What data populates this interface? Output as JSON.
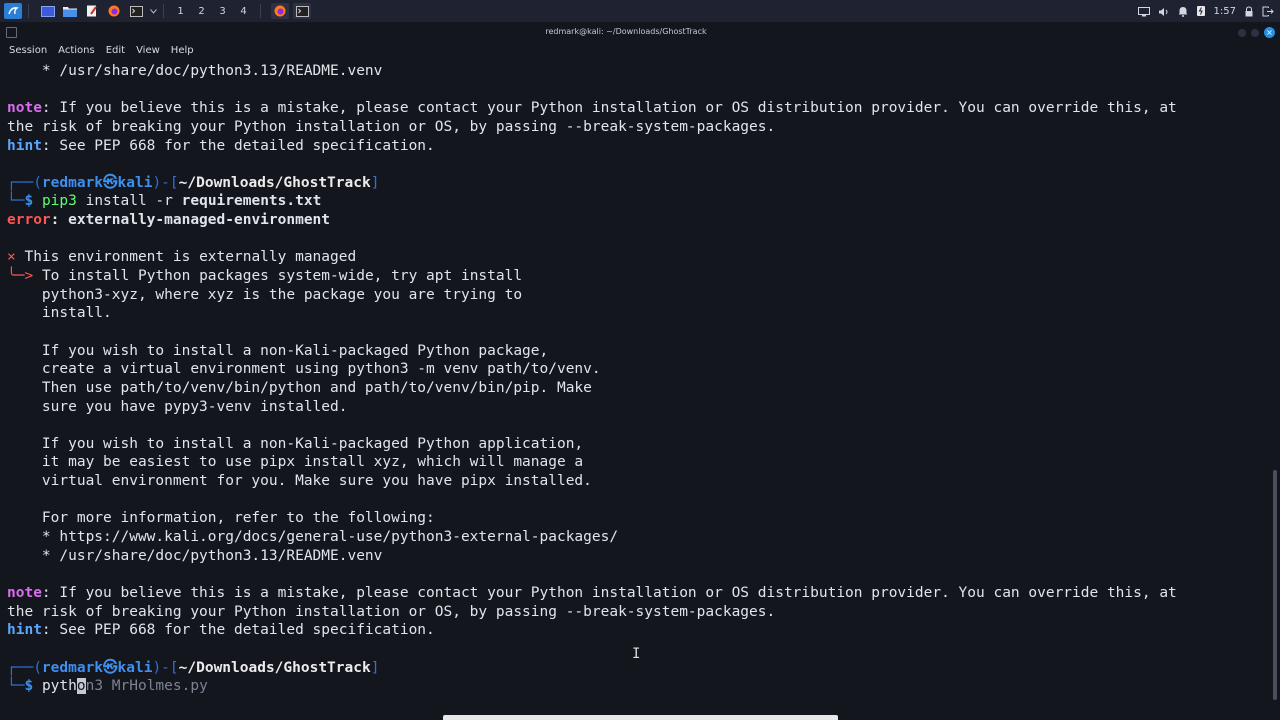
{
  "panel": {
    "workspaces": [
      "1",
      "2",
      "3",
      "4"
    ],
    "clock": "1:57"
  },
  "window": {
    "title": "redmark@kali: ~/Downloads/GhostTrack",
    "close_label": "×"
  },
  "menubar": {
    "items": [
      "Session",
      "Actions",
      "Edit",
      "View",
      "Help"
    ]
  },
  "terminal": {
    "readme_line": "* /usr/share/doc/python3.13/README.venv",
    "note_label": "note",
    "note_text_1": ": If you believe this is a mistake, please contact your Python installation or OS distribution provider. You can override this, at",
    "note_text_2": "the risk of breaking your Python installation or OS, by passing --break-system-packages.",
    "hint_label": "hint",
    "hint_text": ": See PEP 668 for the detailed specification.",
    "prompt_open": "┌──(",
    "prompt_user": "redmark㉿kali",
    "prompt_mid": ")-[",
    "prompt_path": "~/Downloads/GhostTrack",
    "prompt_close": "]",
    "prompt_line2": "└─",
    "prompt_symbol": "$",
    "cmd1_program": "pip3",
    "cmd1_args": " install -r ",
    "cmd1_file": "requirements.txt",
    "error_label": "error",
    "error_text": ": externally-managed-environment",
    "x_marker": "×",
    "arrow_marker": "╰─>",
    "env_title": "This environment is externally managed",
    "msg_lines_a": [
      "To install Python packages system-wide, try apt install",
      "python3-xyz, where xyz is the package you are trying to",
      "install."
    ],
    "msg_lines_b": [
      "If you wish to install a non-Kali-packaged Python package,",
      "create a virtual environment using python3 -m venv path/to/venv.",
      "Then use path/to/venv/bin/python and path/to/venv/bin/pip. Make",
      "sure you have pypy3-venv installed."
    ],
    "msg_lines_c": [
      "If you wish to install a non-Kali-packaged Python application,",
      "it may be easiest to use pipx install xyz, which will manage a",
      "virtual environment for you. Make sure you have pipx installed."
    ],
    "msg_lines_d": [
      "For more information, refer to the following:",
      "* https://www.kali.org/docs/general-use/python3-external-packages/",
      "* /usr/share/doc/python3.13/README.venv"
    ],
    "cmd2_typed": "pyth",
    "cmd2_cursor": "o",
    "cmd2_suggest": "n3 MrHolmes.py"
  },
  "colors": {
    "background": "#14161e",
    "note": "#d96cf0",
    "hint": "#5aa7ff",
    "error": "#ff5557",
    "prompt": "#3d8ff0",
    "command": "#5cff71"
  }
}
